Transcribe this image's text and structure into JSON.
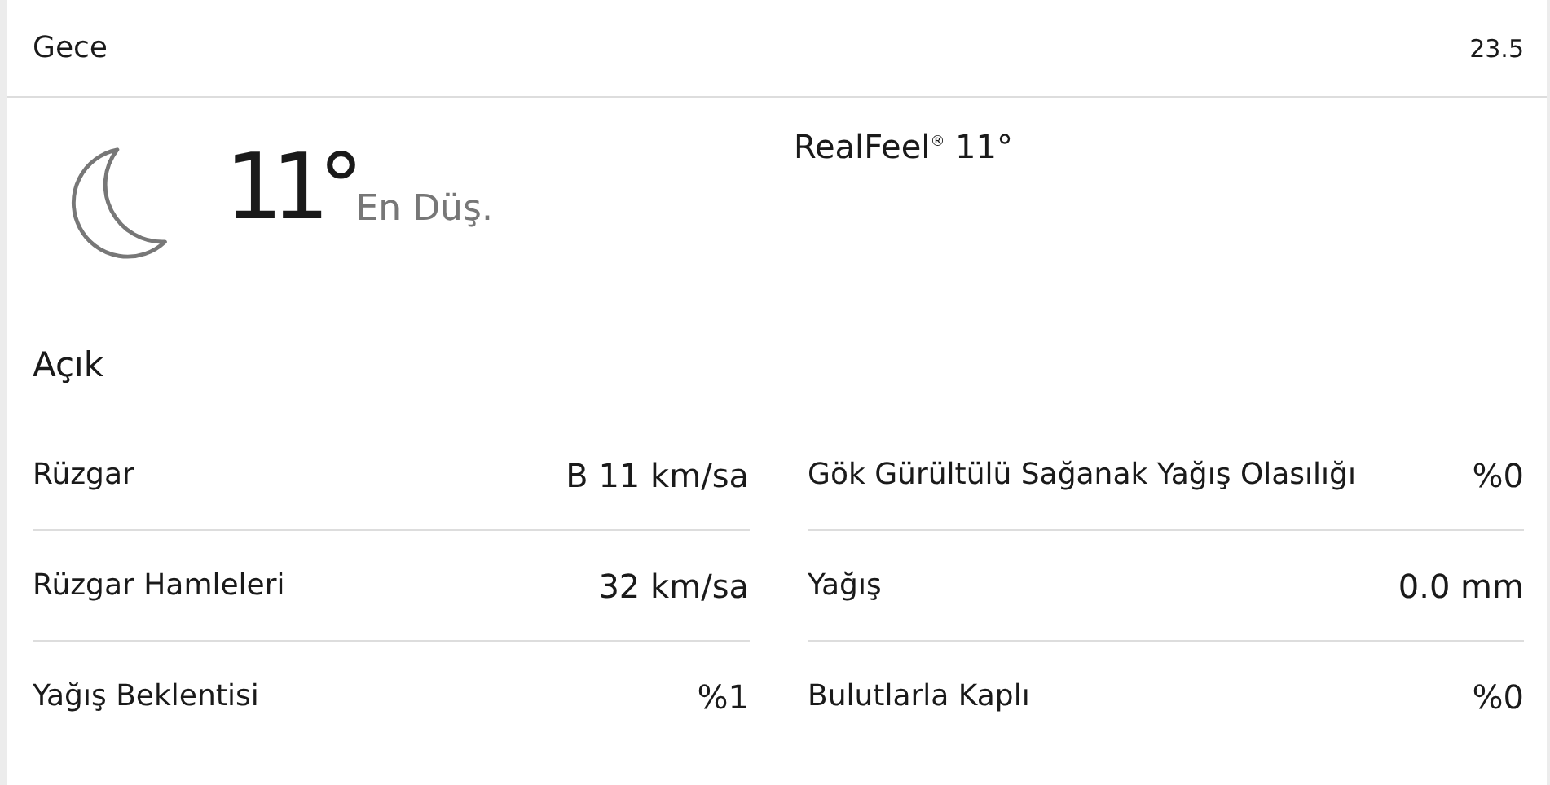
{
  "header": {
    "title": "Gece",
    "date": "23.5"
  },
  "forecast": {
    "temperature": "11°",
    "temperature_label": "En Düş.",
    "realfeel": "RealFeel$^{®}$ 11°",
    "phrase": "Açık"
  },
  "details_left": [
    {
      "label": "Rüzgar",
      "value": "B 11 km/sa"
    },
    {
      "label": "Rüzgar Hamleleri",
      "value": "32 km/sa"
    },
    {
      "label": "Yağış Beklentisi",
      "value": "%1"
    }
  ],
  "details_right": [
    {
      "label": "Gök Gürültülü Sağanak Yağış Olasılığı",
      "value": "%0"
    },
    {
      "label": "Yağış",
      "value": "0.0 mm"
    },
    {
      "label": "Bulutlarla Kaplı",
      "value": "%0"
    }
  ]
}
